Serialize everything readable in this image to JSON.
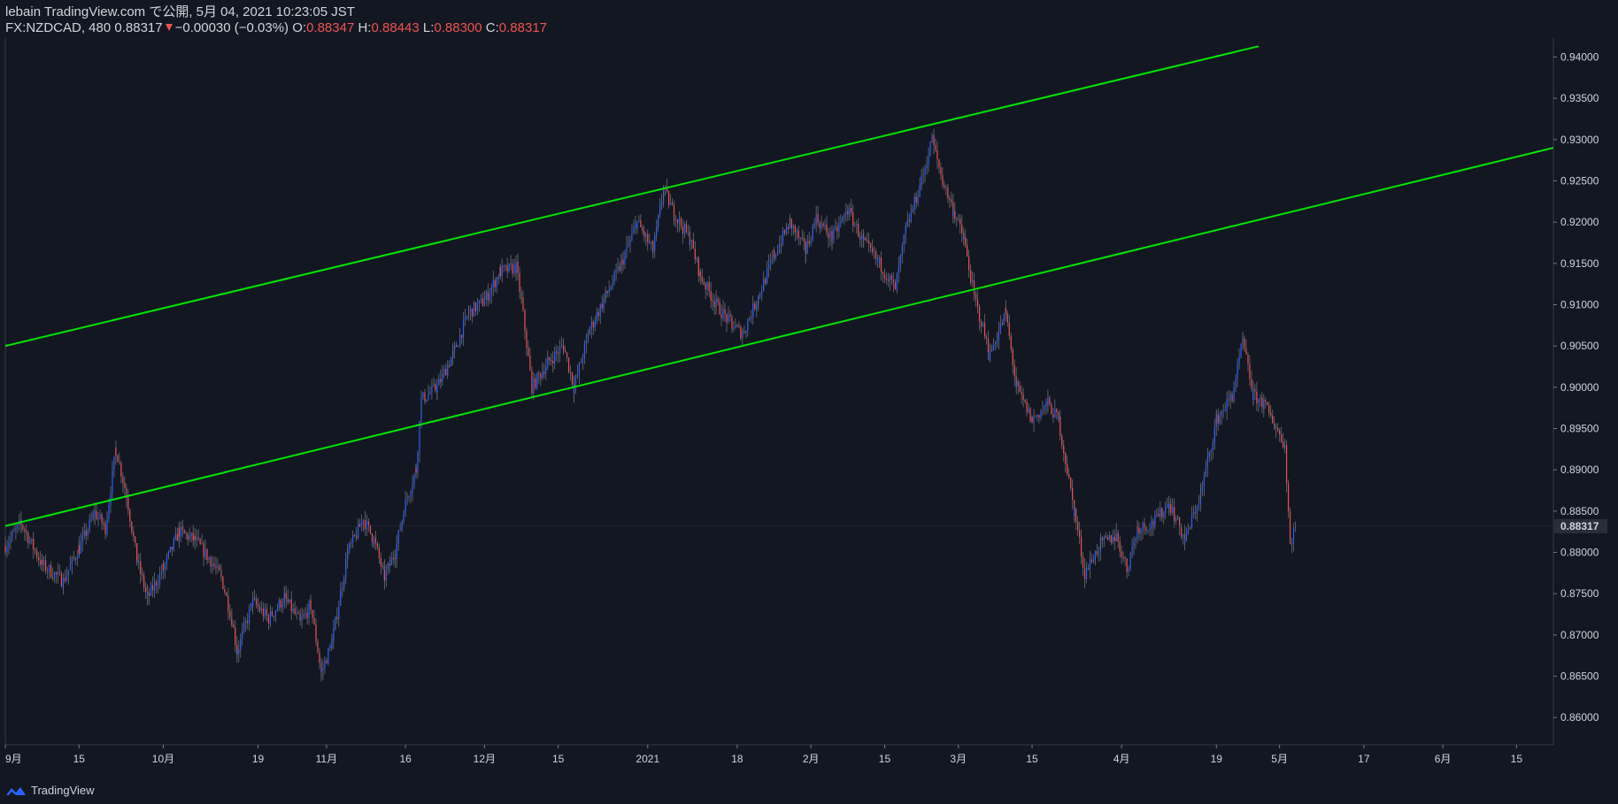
{
  "header": {
    "published": "lebain TradingView.com で公開, 5月 04, 2021 10:23:05 JST",
    "symbol": "FX:NZDCAD, 480",
    "last": "0.88317",
    "change": "−0.00030 (−0.03%)",
    "open_label": "O:",
    "open": "0.88347",
    "high_label": "H:",
    "high": "0.88443",
    "low_label": "L:",
    "low": "0.88300",
    "close_label": "C:",
    "close": "0.88317"
  },
  "footer": {
    "brand": "TradingView",
    "logo_icon": "tradingview-logo-icon"
  },
  "colors": {
    "background": "#131722",
    "up": "#2962ff",
    "down": "#ef5350",
    "channel": "#00e600",
    "text": "#d1d4dc"
  },
  "chart_data": {
    "type": "candlestick",
    "symbol": "FX:NZDCAD",
    "interval": "480",
    "last_price": 0.88317,
    "last_price_label": "0.88317",
    "y_ticks": [
      "0.94000",
      "0.93500",
      "0.93000",
      "0.92500",
      "0.92000",
      "0.91500",
      "0.91000",
      "0.90500",
      "0.90000",
      "0.89500",
      "0.89000",
      "0.88500",
      "0.88000",
      "0.87500",
      "0.87000",
      "0.86500",
      "0.86000"
    ],
    "x_ticks": [
      "9月",
      "15",
      "10月",
      "19",
      "11月",
      "16",
      "12月",
      "15",
      "2021",
      "18",
      "2月",
      "15",
      "3月",
      "15",
      "4月",
      "19",
      "5月",
      "17",
      "6月",
      "15"
    ],
    "x_range": [
      "2020-09-01",
      "2021-06-22"
    ],
    "y_range": [
      0.8567,
      0.9423
    ],
    "channel_lines": [
      {
        "name": "upper",
        "start": {
          "date": "2020-09-01",
          "price": 0.905
        },
        "end": {
          "date": "2021-04-27",
          "price": 0.9413
        }
      },
      {
        "name": "lower",
        "start": {
          "date": "2020-09-01",
          "price": 0.8832
        },
        "end": {
          "date": "2021-06-22",
          "price": 0.929
        }
      }
    ],
    "close_path": [
      [
        "2020-09-01",
        0.8808
      ],
      [
        "2020-09-04",
        0.8835
      ],
      [
        "2020-09-08",
        0.8785
      ],
      [
        "2020-09-12",
        0.8765
      ],
      [
        "2020-09-15",
        0.8805
      ],
      [
        "2020-09-18",
        0.8848
      ],
      [
        "2020-09-20",
        0.883
      ],
      [
        "2020-09-22",
        0.8925
      ],
      [
        "2020-09-24",
        0.887
      ],
      [
        "2020-09-26",
        0.879
      ],
      [
        "2020-09-28",
        0.8745
      ],
      [
        "2020-10-01",
        0.878
      ],
      [
        "2020-10-04",
        0.8825
      ],
      [
        "2020-10-07",
        0.8815
      ],
      [
        "2020-10-10",
        0.879
      ],
      [
        "2020-10-12",
        0.877
      ],
      [
        "2020-10-14",
        0.872
      ],
      [
        "2020-10-15",
        0.868
      ],
      [
        "2020-10-18",
        0.874
      ],
      [
        "2020-10-21",
        0.872
      ],
      [
        "2020-10-24",
        0.8745
      ],
      [
        "2020-10-27",
        0.8715
      ],
      [
        "2020-10-29",
        0.8735
      ],
      [
        "2020-10-31",
        0.8655
      ],
      [
        "2020-11-02",
        0.869
      ],
      [
        "2020-11-05",
        0.88
      ],
      [
        "2020-11-08",
        0.884
      ],
      [
        "2020-11-10",
        0.8815
      ],
      [
        "2020-11-12",
        0.877
      ],
      [
        "2020-11-14",
        0.88
      ],
      [
        "2020-11-16",
        0.886
      ],
      [
        "2020-11-18",
        0.89
      ],
      [
        "2020-11-19",
        0.8985
      ],
      [
        "2020-11-22",
        0.9
      ],
      [
        "2020-11-25",
        0.904
      ],
      [
        "2020-11-28",
        0.909
      ],
      [
        "2020-12-01",
        0.9105
      ],
      [
        "2020-12-04",
        0.914
      ],
      [
        "2020-12-07",
        0.9145
      ],
      [
        "2020-12-08",
        0.9105
      ],
      [
        "2020-12-10",
        0.9
      ],
      [
        "2020-12-13",
        0.903
      ],
      [
        "2020-12-16",
        0.905
      ],
      [
        "2020-12-18",
        0.9
      ],
      [
        "2020-12-21",
        0.907
      ],
      [
        "2020-12-24",
        0.911
      ],
      [
        "2020-12-27",
        0.915
      ],
      [
        "2020-12-30",
        0.92
      ],
      [
        "2021-01-02",
        0.9165
      ],
      [
        "2021-01-04",
        0.924
      ],
      [
        "2021-01-06",
        0.921
      ],
      [
        "2021-01-09",
        0.918
      ],
      [
        "2021-01-11",
        0.9135
      ],
      [
        "2021-01-14",
        0.91
      ],
      [
        "2021-01-17",
        0.9075
      ],
      [
        "2021-01-19",
        0.9065
      ],
      [
        "2021-01-22",
        0.911
      ],
      [
        "2021-01-25",
        0.916
      ],
      [
        "2021-01-28",
        0.92
      ],
      [
        "2021-01-31",
        0.9165
      ],
      [
        "2021-02-02",
        0.9205
      ],
      [
        "2021-02-05",
        0.918
      ],
      [
        "2021-02-08",
        0.9215
      ],
      [
        "2021-02-11",
        0.9175
      ],
      [
        "2021-02-14",
        0.915
      ],
      [
        "2021-02-17",
        0.912
      ],
      [
        "2021-02-19",
        0.919
      ],
      [
        "2021-02-22",
        0.925
      ],
      [
        "2021-02-24",
        0.93
      ],
      [
        "2021-02-26",
        0.925
      ],
      [
        "2021-02-28",
        0.9215
      ],
      [
        "2021-03-02",
        0.918
      ],
      [
        "2021-03-04",
        0.911
      ],
      [
        "2021-03-07",
        0.904
      ],
      [
        "2021-03-10",
        0.909
      ],
      [
        "2021-03-12",
        0.9
      ],
      [
        "2021-03-15",
        0.896
      ],
      [
        "2021-03-18",
        0.898
      ],
      [
        "2021-03-20",
        0.896
      ],
      [
        "2021-03-23",
        0.885
      ],
      [
        "2021-03-25",
        0.8775
      ],
      [
        "2021-03-28",
        0.881
      ],
      [
        "2021-03-31",
        0.882
      ],
      [
        "2021-04-02",
        0.878
      ],
      [
        "2021-04-04",
        0.883
      ],
      [
        "2021-04-07",
        0.8835
      ],
      [
        "2021-04-10",
        0.886
      ],
      [
        "2021-04-13",
        0.8815
      ],
      [
        "2021-04-16",
        0.887
      ],
      [
        "2021-04-19",
        0.896
      ],
      [
        "2021-04-22",
        0.899
      ],
      [
        "2021-04-24",
        0.9055
      ],
      [
        "2021-04-26",
        0.899
      ],
      [
        "2021-04-28",
        0.898
      ],
      [
        "2021-04-30",
        0.8955
      ],
      [
        "2021-05-02",
        0.893
      ],
      [
        "2021-05-03",
        0.881
      ],
      [
        "2021-05-04",
        0.8832
      ]
    ],
    "grid": false
  }
}
